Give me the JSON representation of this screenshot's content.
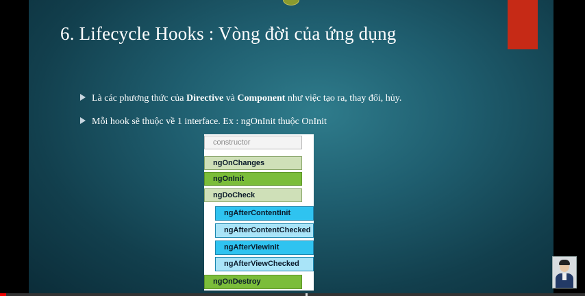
{
  "slide": {
    "title": "6. Lifecycle Hooks : Vòng đời của ứng dụng",
    "bullets": {
      "b1": {
        "prefix": "Là các phương thức của ",
        "bold1": "Directive",
        "mid": " và ",
        "bold2": "Component",
        "suffix": " như việc tạo ra, thay đổi, hủy."
      },
      "b2": "Mỗi hook sẽ thuộc về 1 interface. Ex : ngOnInit thuộc OnInit"
    },
    "diagram": {
      "constructor": "constructor",
      "ngOnChanges": "ngOnChanges",
      "ngOnInit": "ngOnInit",
      "ngDoCheck": "ngDoCheck",
      "ngAfterContentInit": "ngAfterContentInit",
      "ngAfterContentChecked": "ngAfterContentChecked",
      "ngAfterViewInit": "ngAfterViewInit",
      "ngAfterViewChecked": "ngAfterViewChecked",
      "ngOnDestroy": "ngOnDestroy"
    }
  },
  "player": {
    "progress_fraction": 0.01
  },
  "colors": {
    "accent_red": "#c62a16",
    "hook_green": "#7bbd3a",
    "hook_light_green": "#cfe0b8",
    "hook_blue": "#2fc3f0",
    "hook_light_blue": "#a9e4f8"
  }
}
